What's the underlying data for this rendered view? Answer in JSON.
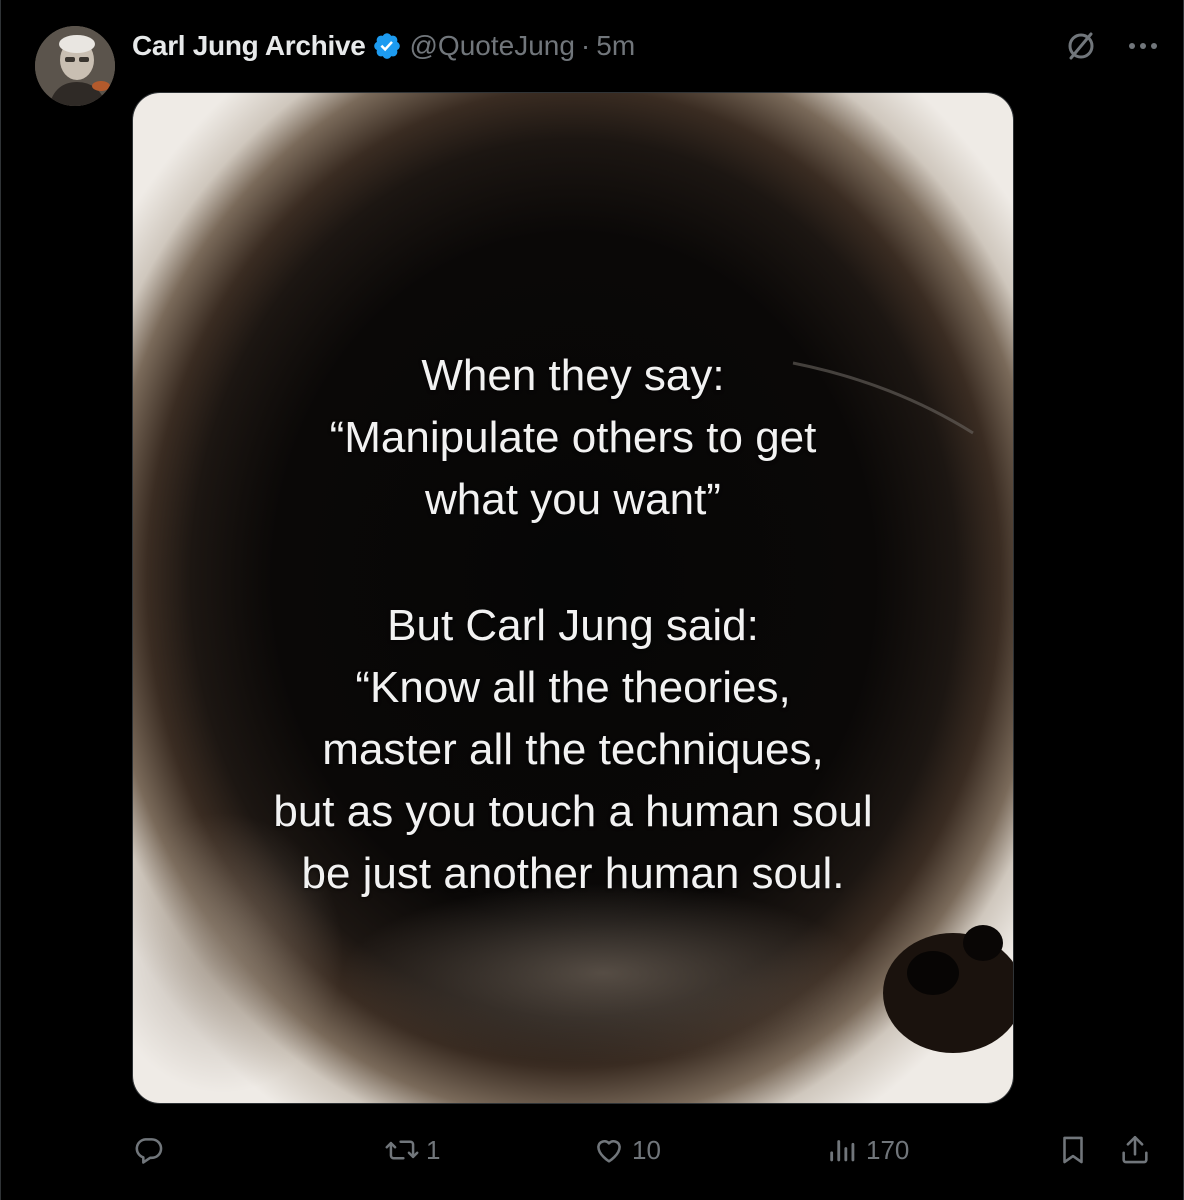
{
  "post": {
    "author": {
      "display_name": "Carl Jung Archive",
      "handle": "@QuoteJung",
      "separator": "·",
      "time": "5m",
      "verified": true,
      "verified_color": "#1d9bf0"
    },
    "image_caption": {
      "block_1": [
        "When they say:",
        "“Manipulate others to get",
        "what you want”"
      ],
      "block_2": [
        "But Carl Jung said:",
        "“Know all the theories,",
        "master all the techniques,",
        "but as you touch a human soul",
        "be just another human soul."
      ]
    },
    "stats": {
      "replies": "",
      "reposts": "1",
      "likes": "10",
      "views": "170"
    }
  },
  "icons": {
    "avatar": "avatar-photo",
    "grok": "slashed-circle-icon",
    "more": "more-dots-icon",
    "reply": "reply-icon",
    "repost": "repost-icon",
    "like": "heart-icon",
    "views": "analytics-icon",
    "bookmark": "bookmark-icon",
    "share": "share-icon"
  },
  "colors": {
    "background": "#000000",
    "text_primary": "#e7e9ea",
    "text_secondary": "#71767b",
    "border": "#2f3336",
    "accent": "#1d9bf0"
  }
}
